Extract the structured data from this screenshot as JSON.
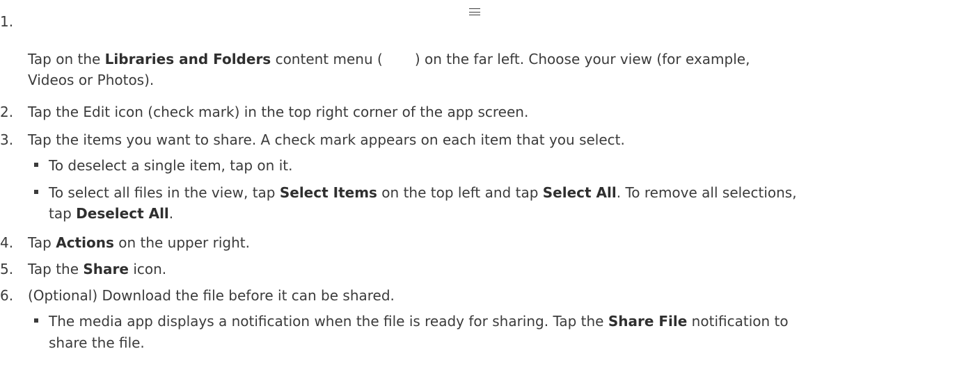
{
  "steps": [
    {
      "num": "1.",
      "line1_pre": "Tap on the ",
      "line1_bold": "Libraries and Folders",
      "line1_mid": " content menu (",
      "line1_post": ") on the far left. Choose your view (for example,",
      "line2": "Videos or Photos).",
      "icon": "hamburger-menu-icon"
    },
    {
      "num": "2.",
      "text": "Tap the Edit icon (check mark) in the top right corner of the app screen."
    },
    {
      "num": "3.",
      "text": "Tap the items you want to share. A check mark appears on each item that you select.",
      "bullets": [
        {
          "text": "To deselect a single item, tap on it."
        },
        {
          "p1": "To select all files in the view, tap ",
          "b1": "Select Items",
          "p2": " on the top left and tap ",
          "b2": "Select All",
          "p3": ". To remove all selections,",
          "p4": "tap ",
          "b3": "Deselect All",
          "p5": "."
        }
      ]
    },
    {
      "num": "4.",
      "pre": "Tap ",
      "bold": "Actions",
      "post": " on the upper right."
    },
    {
      "num": "5.",
      "pre": "Tap the ",
      "bold": "Share",
      "post": " icon."
    },
    {
      "num": "6.",
      "text": "(Optional) Download the file before it can be shared.",
      "bullet": {
        "p1": "The media app displays a notification when the file is ready for sharing. Tap the ",
        "b1": "Share File",
        "p2": " notification to",
        "p3": "share the file."
      }
    }
  ]
}
